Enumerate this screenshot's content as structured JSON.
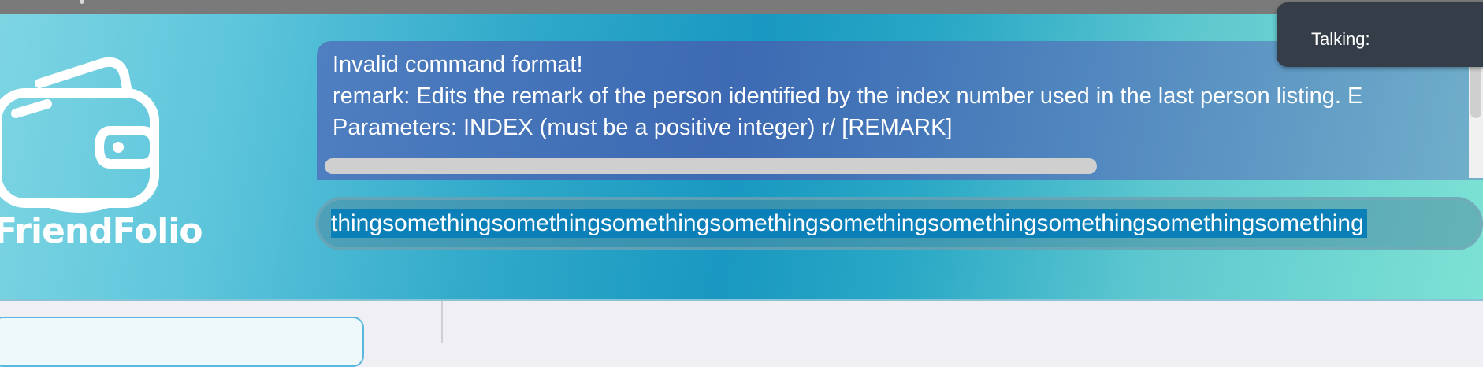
{
  "app": {
    "logo_text": "FriendFolio",
    "logo_icon": "wallet-icon"
  },
  "result": {
    "lines": [
      "Invalid command format!",
      "remark: Edits the remark of the person identified by the index number used in the last person listing. E",
      "Parameters: INDEX (must be a positive integer) r/ [REMARK]"
    ]
  },
  "command": {
    "value": "thingsomethingsomethingsomethingsomethingsomethingsomethingsomethingsomethingsomething"
  },
  "toast": {
    "label": "Talking:"
  },
  "colors": {
    "banner_start": "#7dd5e2",
    "banner_mid": "#1998c1",
    "banner_end": "#7de2d4",
    "result_bg": "#4f77bd",
    "selection": "#0b7fb8",
    "toast_bg": "#353e48"
  }
}
